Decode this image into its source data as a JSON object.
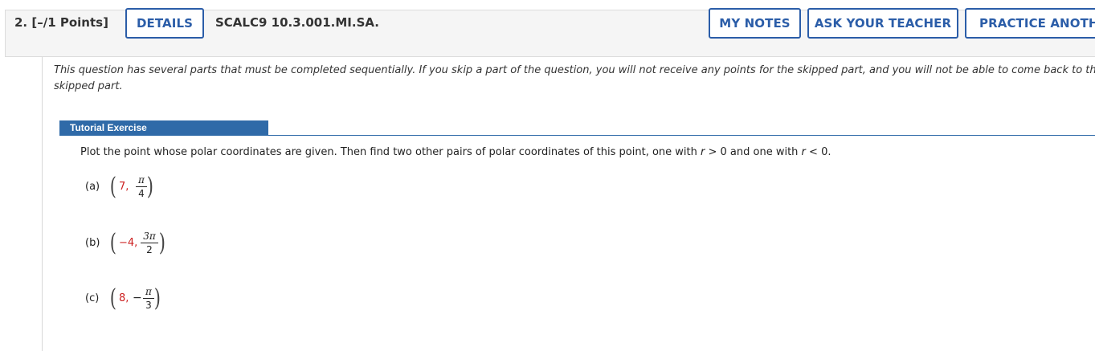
{
  "header": {
    "question_label": "2. [–/1 Points]",
    "details_label": "DETAILS",
    "code": "SCALC9 10.3.001.MI.SA.",
    "my_notes_label": "MY NOTES",
    "ask_teacher_label": "ASK YOUR TEACHER",
    "practice_label": "PRACTICE ANOTHER"
  },
  "intro": {
    "line1": "This question has several parts that must be completed sequentially. If you skip a part of the question, you will not receive any points for the skipped part, and you will not be able to come back to the",
    "line2": "skipped part."
  },
  "tutorial": {
    "tab_label": "Tutorial Exercise",
    "prompt_pre": "Plot the point whose polar coordinates are given. Then find two other pairs of polar coordinates of this point, one with ",
    "var_r": "r",
    "cond1": " > 0 and one with ",
    "cond2": " < 0."
  },
  "parts": [
    {
      "label": "(a)",
      "r": "7,",
      "theta_num": "π",
      "theta_den": "4",
      "theta_sign": ""
    },
    {
      "label": "(b)",
      "r": "−4,",
      "theta_num": "3π",
      "theta_den": "2",
      "theta_sign": ""
    },
    {
      "label": "(c)",
      "r": "8,",
      "theta_num": "π",
      "theta_den": "3",
      "theta_sign": "−"
    }
  ],
  "colors": {
    "accent": "#2b5da8",
    "tab": "#2f6aa8",
    "given_value": "#cc1f1f"
  }
}
